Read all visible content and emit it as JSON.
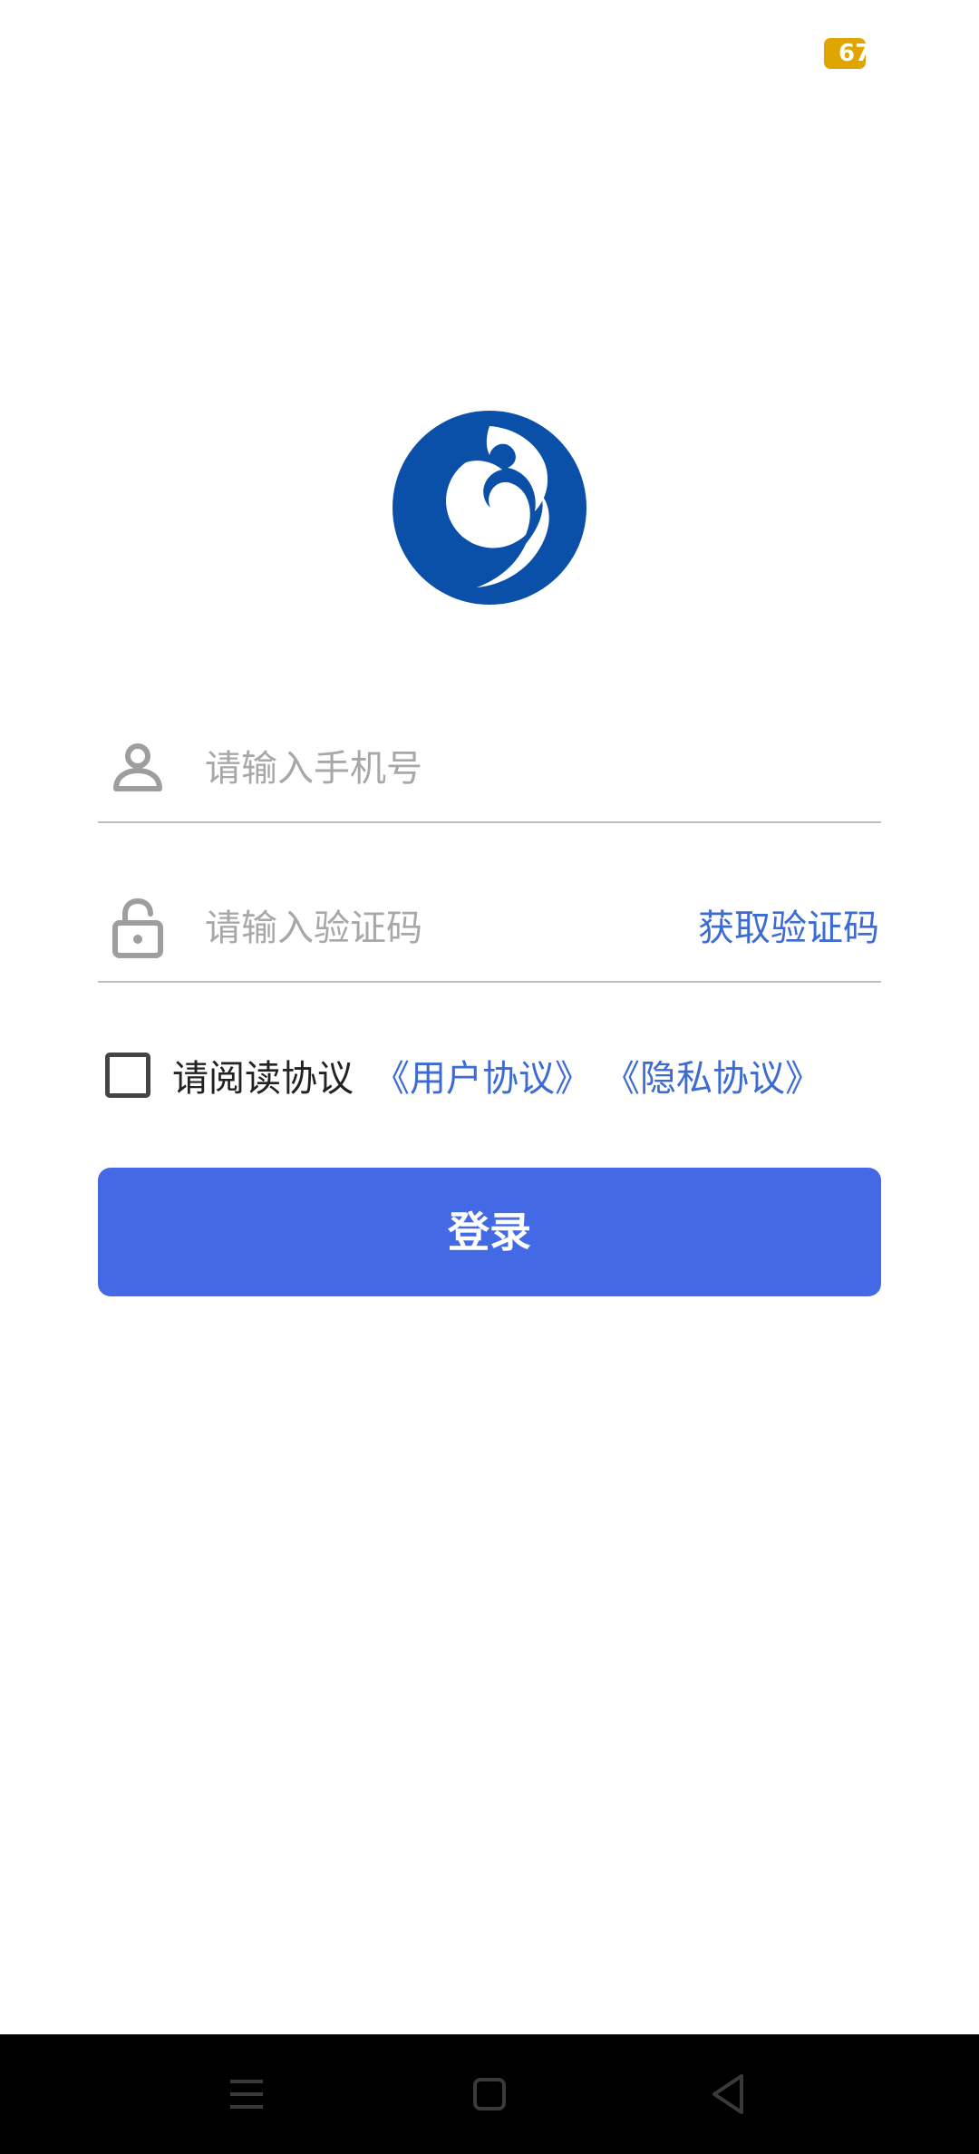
{
  "status_bar": {
    "battery_level": "67",
    "battery_color": "#e0a500"
  },
  "logo": {
    "icon": "blue-swirl-logo-icon",
    "color": "#0a4fa8"
  },
  "login_form": {
    "phone": {
      "icon": "user-icon",
      "placeholder": "请输入手机号",
      "value": ""
    },
    "code": {
      "icon": "lock-icon",
      "placeholder": "请输入验证码",
      "value": "",
      "get_code_label": "获取验证码"
    },
    "agreement": {
      "checked": false,
      "prefix": "请阅读协议",
      "user_agreement": "《用户协议》",
      "privacy_agreement": "《隐私协议》"
    },
    "login_button": "登录"
  },
  "colors": {
    "primary": "#436ae4",
    "link": "#3c6bd3",
    "placeholder": "#a8a8a8",
    "divider": "#bdbdbd"
  },
  "nav_bar": {
    "buttons": [
      "menu-icon",
      "home-icon",
      "back-icon"
    ]
  }
}
